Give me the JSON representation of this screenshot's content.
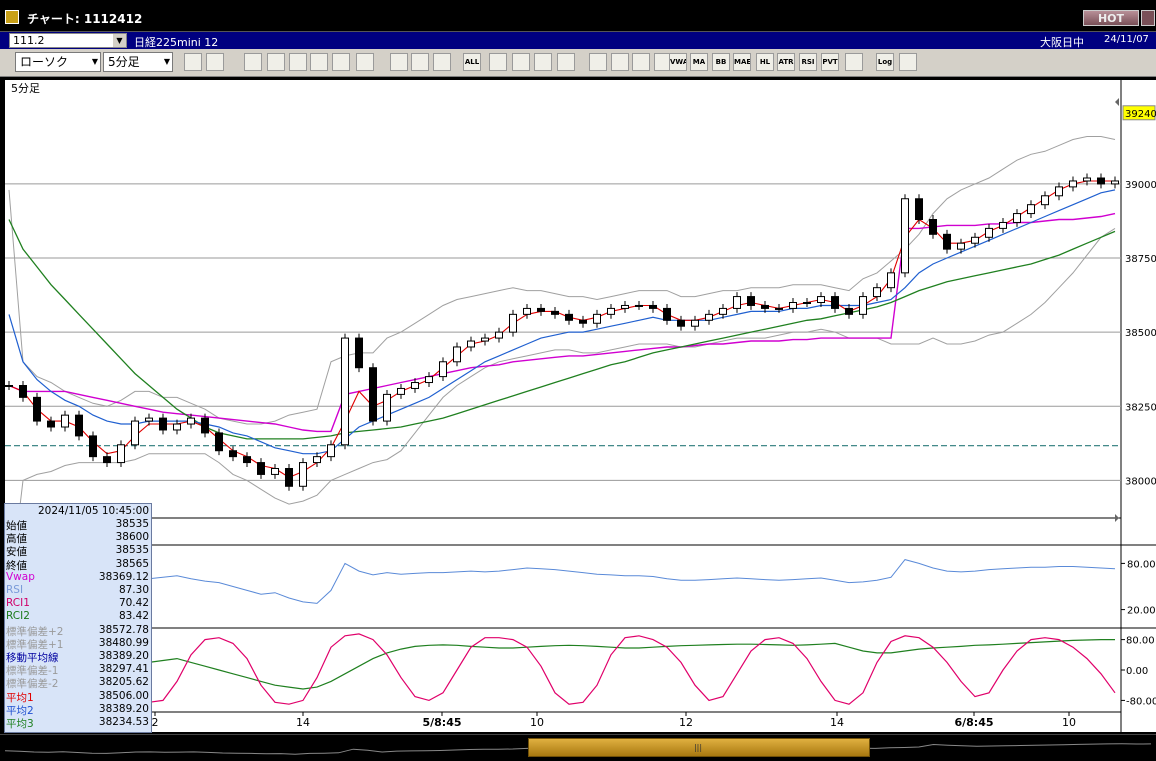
{
  "window": {
    "title": "チャート: 1112412",
    "hot_label": "HOT"
  },
  "instrument": {
    "code": "111.2",
    "name": "日経225mini 12",
    "market": "大阪日中",
    "date": "24/11/07"
  },
  "toolbar": {
    "chart_type": "ローソク",
    "timeframe": "5分足",
    "buttons": [
      {
        "icon": "zoom-icon"
      },
      {
        "icon": "grid-icon"
      },
      {
        "icon": "pencil-icon"
      },
      {
        "icon": "trendline-icon"
      },
      {
        "icon": "cursor-icon"
      },
      {
        "icon": "undo-icon"
      },
      {
        "icon": "print-icon"
      },
      {
        "icon": "trash-icon"
      },
      {
        "icon": "candle-left-icon"
      },
      {
        "icon": "candle-right-icon"
      },
      {
        "icon": "candle-add-icon"
      },
      {
        "icon": "show-all-icon",
        "label": "ALL"
      },
      {
        "icon": "bird-icon"
      },
      {
        "icon": "search-chart-icon"
      },
      {
        "icon": "bar-chart-icon"
      },
      {
        "icon": "plusminus-icon"
      },
      {
        "icon": "stamp-icon"
      },
      {
        "icon": "chip-icon"
      },
      {
        "icon": "wrench-icon"
      },
      {
        "icon": "color-icon"
      },
      {
        "icon": "vwap-icon",
        "label": "VWAP"
      },
      {
        "icon": "ma-icon",
        "label": "MA"
      },
      {
        "icon": "bb-icon",
        "label": "BB"
      },
      {
        "icon": "mae-icon",
        "label": "MAE"
      },
      {
        "icon": "hl-icon",
        "label": "HL"
      },
      {
        "icon": "atr-icon",
        "label": "ATR"
      },
      {
        "icon": "rsi-icon",
        "label": "RSI"
      },
      {
        "icon": "pvt-icon",
        "label": "PVT"
      },
      {
        "icon": "window-icon"
      },
      {
        "icon": "log-icon",
        "label": "Log"
      },
      {
        "icon": "exit-icon"
      }
    ]
  },
  "chart_data": {
    "type": "line",
    "timeframe_label": "5分足",
    "price_axis": {
      "labels": [
        "39240",
        "39000",
        "38750",
        "38500",
        "38250",
        "38000"
      ],
      "ylim": [
        37900,
        39300
      ],
      "current_price": 39240,
      "reference_line": 38117
    },
    "x_axis_labels": [
      "2",
      "14",
      "5/8:45",
      "10",
      "12",
      "14",
      "6/8:45",
      "10"
    ],
    "close_series": [
      38320,
      38280,
      38200,
      38180,
      38220,
      38150,
      38080,
      38060,
      38120,
      38200,
      38210,
      38170,
      38190,
      38210,
      38160,
      38100,
      38080,
      38060,
      38020,
      38040,
      37980,
      38060,
      38080,
      38120,
      38480,
      38380,
      38200,
      38290,
      38310,
      38330,
      38350,
      38400,
      38450,
      38470,
      38480,
      38500,
      38560,
      38580,
      38570,
      38560,
      38540,
      38530,
      38560,
      38580,
      38590,
      38590,
      38580,
      38540,
      38520,
      38540,
      38560,
      38580,
      38620,
      38590,
      38580,
      38580,
      38600,
      38600,
      38620,
      38580,
      38560,
      38620,
      38650,
      38700,
      38950,
      38880,
      38830,
      38780,
      38800,
      38820,
      38850,
      38870,
      38900,
      38930,
      38960,
      38990,
      39010,
      39020,
      39000,
      39010
    ],
    "bollinger_upper_series": [
      38980,
      38400,
      38350,
      38330,
      38300,
      38280,
      38260,
      38250,
      38270,
      38300,
      38300,
      38280,
      38280,
      38260,
      38240,
      38210,
      38200,
      38190,
      38190,
      38200,
      38220,
      38230,
      38240,
      38400,
      38420,
      38430,
      38430,
      38480,
      38500,
      38530,
      38560,
      38590,
      38610,
      38620,
      38630,
      38640,
      38650,
      38640,
      38640,
      38630,
      38620,
      38620,
      38610,
      38620,
      38630,
      38640,
      38640,
      38640,
      38620,
      38620,
      38630,
      38640,
      38640,
      38650,
      38650,
      38650,
      38660,
      38660,
      38660,
      38650,
      38640,
      38680,
      38700,
      38740,
      38780,
      38830,
      38900,
      38950,
      38980,
      39000,
      39020,
      39050,
      39080,
      39100,
      39110,
      39130,
      39150,
      39160,
      39160,
      39150
    ],
    "bollinger_lower_series": [
      37600,
      38000,
      38020,
      38030,
      38050,
      38060,
      38060,
      38060,
      38060,
      38070,
      38090,
      38090,
      38090,
      38090,
      38090,
      38060,
      38020,
      38000,
      37970,
      37940,
      37920,
      37930,
      37950,
      38000,
      38020,
      38040,
      38060,
      38070,
      38100,
      38160,
      38220,
      38280,
      38320,
      38350,
      38380,
      38400,
      38410,
      38420,
      38430,
      38440,
      38440,
      38430,
      38430,
      38440,
      38450,
      38460,
      38460,
      38460,
      38450,
      38450,
      38460,
      38470,
      38480,
      38480,
      38480,
      38490,
      38500,
      38500,
      38510,
      38500,
      38480,
      38480,
      38480,
      38460,
      38460,
      38460,
      38480,
      38460,
      38460,
      38470,
      38490,
      38500,
      38530,
      38560,
      38600,
      38650,
      38700,
      38760,
      38820,
      38850
    ],
    "ma1_series": [
      38320,
      38300,
      38240,
      38200,
      38200,
      38180,
      38130,
      38090,
      38100,
      38150,
      38190,
      38190,
      38190,
      38200,
      38180,
      38140,
      38100,
      38080,
      38050,
      38040,
      38010,
      38030,
      38060,
      38110,
      38200,
      38300,
      38250,
      38270,
      38300,
      38320,
      38340,
      38380,
      38420,
      38460,
      38470,
      38490,
      38530,
      38560,
      38570,
      38570,
      38550,
      38540,
      38550,
      38570,
      38580,
      38590,
      38590,
      38560,
      38540,
      38540,
      38550,
      38570,
      38590,
      38600,
      38590,
      38580,
      38590,
      38600,
      38610,
      38600,
      38570,
      38590,
      38620,
      38680,
      38820,
      38880,
      38850,
      38800,
      38800,
      38810,
      38840,
      38860,
      38890,
      38920,
      38950,
      38980,
      39000,
      39010,
      39010,
      39010
    ],
    "ma2_series": [
      38560,
      38400,
      38340,
      38300,
      38270,
      38250,
      38220,
      38200,
      38190,
      38190,
      38200,
      38200,
      38200,
      38200,
      38190,
      38180,
      38160,
      38150,
      38130,
      38110,
      38100,
      38090,
      38090,
      38100,
      38140,
      38180,
      38200,
      38220,
      38240,
      38260,
      38280,
      38310,
      38340,
      38370,
      38400,
      38420,
      38440,
      38460,
      38480,
      38490,
      38500,
      38500,
      38510,
      38520,
      38530,
      38540,
      38550,
      38540,
      38540,
      38540,
      38540,
      38550,
      38560,
      38570,
      38570,
      38570,
      38580,
      38580,
      38590,
      38590,
      38590,
      38590,
      38600,
      38610,
      38650,
      38700,
      38730,
      38750,
      38770,
      38790,
      38810,
      38830,
      38850,
      38870,
      38890,
      38910,
      38930,
      38950,
      38970,
      38980
    ],
    "ma3_series": [
      38880,
      38780,
      38720,
      38660,
      38610,
      38560,
      38510,
      38460,
      38410,
      38360,
      38320,
      38280,
      38240,
      38210,
      38180,
      38160,
      38150,
      38140,
      38140,
      38140,
      38140,
      38140,
      38145,
      38150,
      38160,
      38165,
      38170,
      38175,
      38180,
      38190,
      38200,
      38210,
      38225,
      38240,
      38255,
      38270,
      38285,
      38300,
      38315,
      38330,
      38345,
      38360,
      38375,
      38390,
      38400,
      38415,
      38430,
      38440,
      38450,
      38460,
      38470,
      38480,
      38490,
      38500,
      38510,
      38520,
      38530,
      38540,
      38545,
      38555,
      38565,
      38575,
      38585,
      38600,
      38620,
      38640,
      38655,
      38670,
      38680,
      38690,
      38700,
      38710,
      38720,
      38730,
      38745,
      38760,
      38780,
      38800,
      38820,
      38840
    ],
    "vwap_series": [
      38320,
      38300,
      38300,
      38300,
      38300,
      38290,
      38280,
      38270,
      38260,
      38250,
      38240,
      38230,
      38225,
      38220,
      38215,
      38210,
      38205,
      38200,
      38195,
      38190,
      38180,
      38170,
      38165,
      38165,
      38290,
      38300,
      38310,
      38320,
      38330,
      38340,
      38350,
      38360,
      38370,
      38380,
      38385,
      38390,
      38400,
      38405,
      38410,
      38415,
      38420,
      38420,
      38425,
      38430,
      38435,
      38440,
      38445,
      38450,
      38450,
      38455,
      38460,
      38460,
      38465,
      38470,
      38470,
      38470,
      38475,
      38475,
      38480,
      38480,
      38480,
      38480,
      38480,
      38480,
      38850,
      38850,
      38855,
      38860,
      38860,
      38860,
      38865,
      38865,
      38870,
      38870,
      38875,
      38880,
      38880,
      38885,
      38890,
      38900
    ],
    "rsi_panel": {
      "labels": [
        "80.00",
        "20.00"
      ],
      "ylim": [
        0,
        100
      ],
      "series": [
        55,
        50,
        48,
        52,
        47,
        45,
        44,
        50,
        55,
        58,
        60,
        62,
        64,
        60,
        57,
        55,
        50,
        45,
        40,
        42,
        35,
        30,
        28,
        45,
        80,
        70,
        65,
        68,
        66,
        67,
        68,
        68,
        69,
        70,
        69,
        70,
        72,
        74,
        73,
        72,
        70,
        68,
        66,
        65,
        64,
        64,
        63,
        60,
        58,
        58,
        59,
        60,
        61,
        60,
        59,
        58,
        59,
        60,
        61,
        58,
        55,
        56,
        58,
        62,
        85,
        80,
        74,
        70,
        69,
        70,
        72,
        73,
        74,
        75,
        75,
        76,
        76,
        75,
        74,
        73
      ]
    },
    "rci_panel": {
      "labels": [
        "80.00",
        "0.00",
        "-80.00"
      ],
      "ylim": [
        -100,
        100
      ],
      "rci1_series": [
        -80,
        -70,
        -20,
        40,
        75,
        80,
        60,
        10,
        -40,
        -80,
        -85,
        -80,
        -30,
        40,
        80,
        85,
        70,
        30,
        -40,
        -85,
        -90,
        -80,
        -20,
        60,
        90,
        95,
        80,
        40,
        -20,
        -70,
        -80,
        -60,
        0,
        60,
        85,
        85,
        80,
        60,
        10,
        -60,
        -90,
        -85,
        -40,
        40,
        85,
        90,
        80,
        60,
        20,
        -40,
        -80,
        -70,
        -10,
        50,
        80,
        85,
        70,
        30,
        -30,
        -80,
        -90,
        -60,
        20,
        75,
        90,
        85,
        60,
        20,
        -30,
        -70,
        -60,
        0,
        50,
        80,
        85,
        80,
        60,
        30,
        -10,
        -60
      ],
      "rci2_series": [
        -90,
        -85,
        -75,
        -60,
        -45,
        -30,
        -15,
        0,
        10,
        15,
        20,
        25,
        30,
        20,
        10,
        0,
        -10,
        -20,
        -30,
        -40,
        -45,
        -50,
        -45,
        -30,
        -10,
        10,
        30,
        45,
        55,
        62,
        65,
        66,
        65,
        62,
        60,
        58,
        58,
        60,
        62,
        64,
        65,
        64,
        62,
        60,
        58,
        58,
        60,
        62,
        64,
        65,
        66,
        67,
        68,
        68,
        67,
        66,
        65,
        66,
        68,
        70,
        60,
        50,
        45,
        45,
        50,
        55,
        58,
        60,
        62,
        65,
        66,
        68,
        70,
        72,
        74,
        76,
        78,
        79,
        80,
        80
      ]
    }
  },
  "info_panel": {
    "datetime": "2024/11/05  10:45:00",
    "rows": [
      {
        "label": "始値",
        "value": "38535",
        "color": "#000000"
      },
      {
        "label": "高値",
        "value": "38600",
        "color": "#000000"
      },
      {
        "label": "安値",
        "value": "38535",
        "color": "#000000"
      },
      {
        "label": "終値",
        "value": "38565",
        "color": "#000000"
      },
      {
        "label": "Vwap",
        "value": "38369.12",
        "color": "#d000d0"
      },
      {
        "label": "RSI",
        "value": "87.30",
        "color": "#7a9ad8"
      },
      {
        "label": "RCI1",
        "value": "70.42",
        "color": "#d0006a"
      },
      {
        "label": "RCI2",
        "value": "83.42",
        "color": "#1a7a1a"
      },
      {
        "label": "標準偏差+2",
        "value": "38572.78",
        "color": "#9a9a9a"
      },
      {
        "label": "標準偏差+1",
        "value": "38480.99",
        "color": "#9a9a9a"
      },
      {
        "label": "移動平均線",
        "value": "38389.20",
        "color": "#0000a0"
      },
      {
        "label": "標準偏差-1",
        "value": "38297.41",
        "color": "#9a9a9a"
      },
      {
        "label": "標準偏差-2",
        "value": "38205.62",
        "color": "#9a9a9a"
      },
      {
        "label": "平均1",
        "value": "38506.00",
        "color": "#e00000"
      },
      {
        "label": "平均2",
        "value": "38389.20",
        "color": "#2050d0"
      },
      {
        "label": "平均3",
        "value": "38234.53",
        "color": "#208020"
      }
    ]
  },
  "colors": {
    "ma1": "#e00000",
    "ma2": "#2060d0",
    "ma3": "#208020",
    "vwap": "#d000d0",
    "bollinger": "#a0a0a0",
    "rsi": "#5a8ad8",
    "rci1": "#e0006a",
    "rci2": "#208020",
    "reference_line": "#2a7a7a"
  }
}
